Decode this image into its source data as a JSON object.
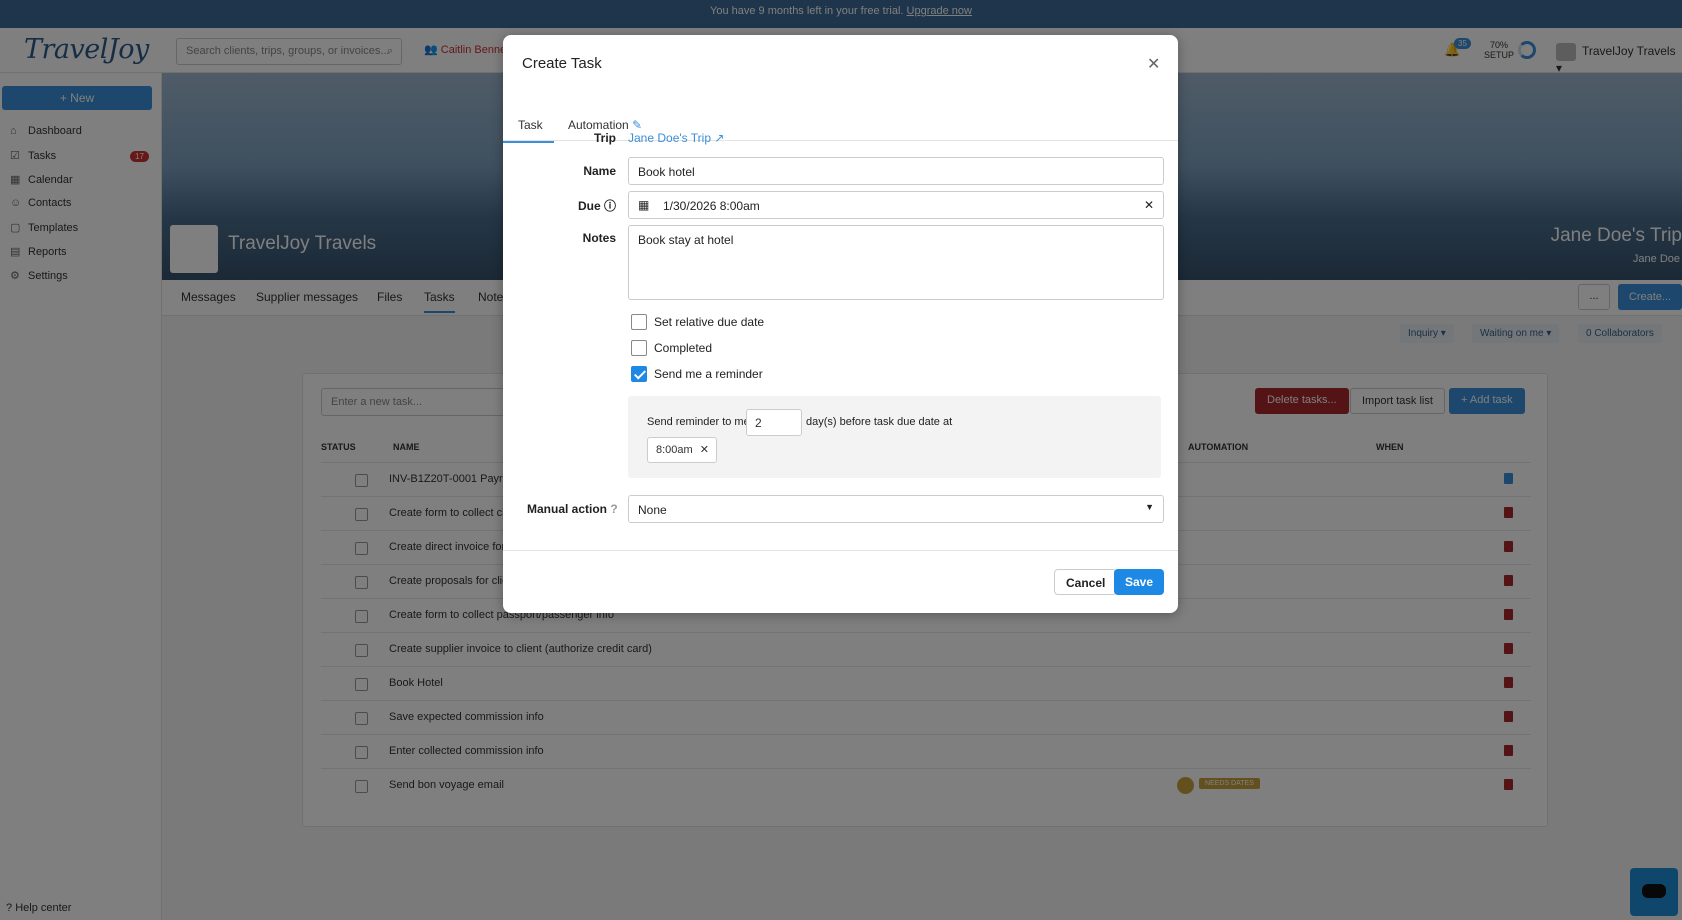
{
  "trial": {
    "text": "You have 9 months left in your free trial.",
    "link": "Upgrade now"
  },
  "app": {
    "logo": "TravelJoy",
    "search_placeholder": "Search clients, trips, groups, or invoices...",
    "user_chip": "Caitlin Benne",
    "notif_count": "35",
    "setup_pct": "70%",
    "setup_label": "SETUP",
    "account": "TravelJoy Travels"
  },
  "sidebar": {
    "new_label": "+ New",
    "items": [
      {
        "label": "Dashboard",
        "icon": "home-icon"
      },
      {
        "label": "Tasks",
        "icon": "check-square-icon",
        "badge": "17"
      },
      {
        "label": "Calendar",
        "icon": "calendar-icon"
      },
      {
        "label": "Contacts",
        "icon": "user-icon"
      },
      {
        "label": "Templates",
        "icon": "file-icon"
      },
      {
        "label": "Reports",
        "icon": "chart-icon"
      },
      {
        "label": "Settings",
        "icon": "gear-icon"
      }
    ],
    "help": "Help center"
  },
  "hero": {
    "brand": "TravelJoy Travels",
    "trip": "Jane Doe's Trip",
    "trip_sub": "Jane Doe"
  },
  "tabs": [
    "Messages",
    "Supplier messages",
    "Files",
    "Tasks",
    "Note"
  ],
  "header_actions": {
    "more": "...",
    "create": "Create...",
    "inquiry": "Inquiry",
    "waiting": "Waiting on me",
    "collab": "0 Collaborators"
  },
  "tasks": {
    "new_placeholder": "Enter a new task...",
    "delete": "Delete tasks...",
    "import": "Import task list",
    "add": "+ Add task",
    "columns": {
      "status": "STATUS",
      "name": "NAME",
      "automation": "AUTOMATION",
      "when": "WHEN"
    },
    "rows": [
      "INV-B1Z20T-0001 Payr",
      "Create form to collect cl",
      "Create direct invoice for",
      "Create proposals for clie",
      "Create form to collect passport/passenger info",
      "Create supplier invoice to client (authorize credit card)",
      "Book Hotel",
      "Save expected commission info",
      "Enter collected commission info",
      "Send bon voyage email"
    ],
    "needs_dates": "NEEDS DATES"
  },
  "modal": {
    "title": "Create Task",
    "tab_task": "Task",
    "tab_automation": "Automation",
    "trip_label": "Trip",
    "trip_value": "Jane Doe's Trip",
    "name_label": "Name",
    "name_value": "Book hotel",
    "due_label": "Due",
    "due_value": "1/30/2026 8:00am",
    "notes_label": "Notes",
    "notes_value": "Book stay at hotel",
    "relative_due": "Set relative due date",
    "completed": "Completed",
    "reminder": "Send me a reminder",
    "reminder_prefix": "Send reminder to me",
    "reminder_days": "2",
    "reminder_suffix": "day(s) before task due date at",
    "reminder_time": "8:00am",
    "manual_label": "Manual action",
    "manual_value": "None",
    "cancel": "Cancel",
    "save": "Save"
  }
}
